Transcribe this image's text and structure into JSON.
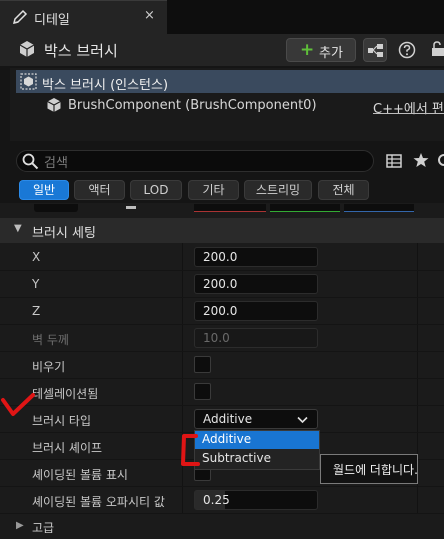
{
  "tab": {
    "title": "디테일",
    "close": "×"
  },
  "header": {
    "title": "박스 브러시",
    "add_label": "추가"
  },
  "tree": {
    "root_label": "박스 브러시 (인스턴스)",
    "child_label": "BrushComponent (BrushComponent0)",
    "edit_label": "C++에서 편집"
  },
  "search": {
    "placeholder": "검색"
  },
  "filters": [
    {
      "label": "일반",
      "active": true
    },
    {
      "label": "액터",
      "active": false
    },
    {
      "label": "LOD",
      "active": false
    },
    {
      "label": "기타",
      "active": false
    },
    {
      "label": "스트리밍",
      "active": false
    },
    {
      "label": "전체",
      "active": false
    }
  ],
  "section": {
    "title": "브러시 세팅"
  },
  "properties": {
    "x": {
      "label": "X",
      "value": "200.0"
    },
    "y": {
      "label": "Y",
      "value": "200.0"
    },
    "z": {
      "label": "Z",
      "value": "200.0"
    },
    "wall": {
      "label": "벽 두께",
      "value": "10.0",
      "enabled": false
    },
    "hollow": {
      "label": "비우기",
      "checked": false
    },
    "tessellated": {
      "label": "테셀레이션됨",
      "checked": false
    },
    "brush_type": {
      "label": "브러시 타입",
      "value": "Additive"
    },
    "brush_shape": {
      "label": "브러시 셰이프"
    },
    "show_shaded": {
      "label": "셰이딩된 볼륨 표시",
      "checked": false
    },
    "opacity": {
      "label": "셰이딩된 볼륨 오파시티 값",
      "value": "0.25"
    }
  },
  "dropdown": {
    "options": [
      "Additive",
      "Subtractive"
    ],
    "highlighted": "Additive"
  },
  "tooltip": {
    "text": "월드에 더합니다."
  },
  "advanced": {
    "label": "고급"
  },
  "colors": {
    "accent": "#1978d6",
    "add_icon": "#5fbf3a",
    "annotation": "#e01515"
  }
}
